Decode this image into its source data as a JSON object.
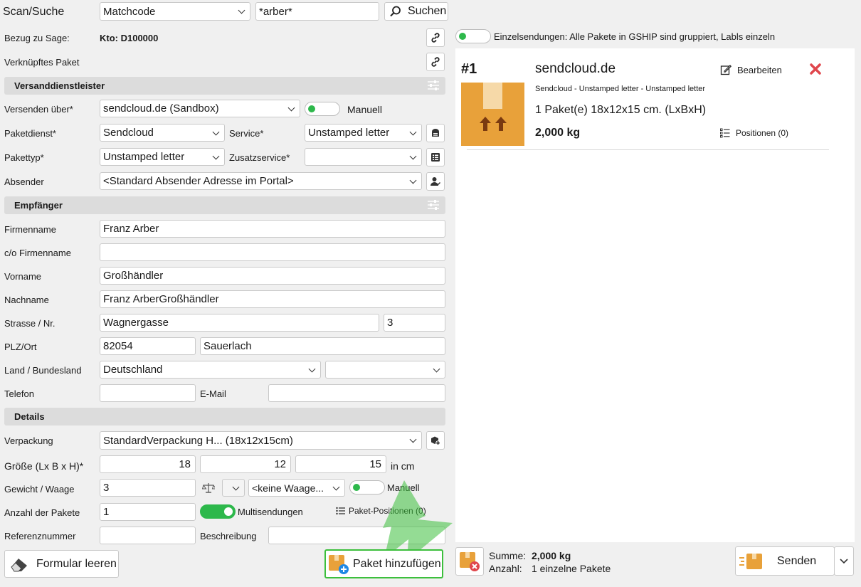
{
  "scan": {
    "label": "Scan/Suche",
    "mode": "Matchcode",
    "query": "*arber*",
    "search_label": "Suchen"
  },
  "bezug": {
    "label": "Bezug zu Sage:",
    "value": "Kto: D100000"
  },
  "linked": {
    "label": "Verknüpftes Paket"
  },
  "sections": {
    "carrier": "Versanddienstleister",
    "recipient": "Empfänger",
    "details": "Details"
  },
  "carrier": {
    "send_via_label": "Versenden über*",
    "send_via": "sendcloud.de (Sandbox)",
    "manual_label": "Manuell",
    "service_provider_label": "Paketdienst*",
    "service_provider": "Sendcloud",
    "service_label": "Service*",
    "service": "Unstamped letter",
    "package_type_label": "Pakettyp*",
    "package_type": "Unstamped letter",
    "extra_service_label": "Zusatzservice*",
    "extra_service": "",
    "sender_label": "Absender",
    "sender": "<Standard Absender Adresse im Portal>"
  },
  "recipient": {
    "company_label": "Firmenname",
    "company": "Franz Arber",
    "co_label": "c/o Firmenname",
    "co": "",
    "firstname_label": "Vorname",
    "firstname": "Großhändler",
    "lastname_label": "Nachname",
    "lastname": "Franz ArberGroßhändler",
    "street_label": "Strasse / Nr.",
    "street": "Wagnergasse",
    "number": "3",
    "city_label": "PLZ/Ort",
    "zip": "82054",
    "city": "Sauerlach",
    "country_label": "Land / Bundesland",
    "country": "Deutschland",
    "state": "",
    "phone_label": "Telefon",
    "phone": "",
    "email_label": "E-Mail",
    "email": ""
  },
  "details": {
    "packaging_label": "Verpackung",
    "packaging": "StandardVerpackung H... (18x12x15cm)",
    "size_label": "Größe (Lx B x H)*",
    "length": "18",
    "width": "12",
    "height": "15",
    "size_unit": "in cm",
    "weight_label": "Gewicht / Waage",
    "weight": "3",
    "scale": "<keine Waage...",
    "manual_label": "Manuell",
    "count_label": "Anzahl der Pakete",
    "count": "1",
    "multi_label": "Multisendungen",
    "positions_label": "Paket-Positionen (0)",
    "reference_label": "Referenznummer",
    "reference": "",
    "description_label": "Beschreibung",
    "description": ""
  },
  "buttons": {
    "clear": "Formular leeren",
    "add_package": "Paket hinzufügen",
    "send": "Senden"
  },
  "right": {
    "single_toggle_label": "Einzelsendungen: Alle Pakete in GSHIP sind gruppiert, Labls einzeln",
    "card": {
      "index": "#1",
      "carrier": "sendcloud.de",
      "edit": "Bearbeiten",
      "service_line": "Sendcloud - Unstamped letter - Unstamped letter",
      "dims": "1 Paket(e) 18x12x15 cm. (LxBxH)",
      "weight": "2,000 kg",
      "positions": "Positionen (0)"
    },
    "sum_label": "Summe:",
    "sum_value": "2,000 kg",
    "count_label": "Anzahl:",
    "count_value": "1 einzelne Pakete"
  },
  "colors": {
    "box_orange": "#e8a13a",
    "toggle_green": "#2db84b",
    "delete_red": "#e0464c",
    "highlight_green": "#3cbf3c"
  }
}
